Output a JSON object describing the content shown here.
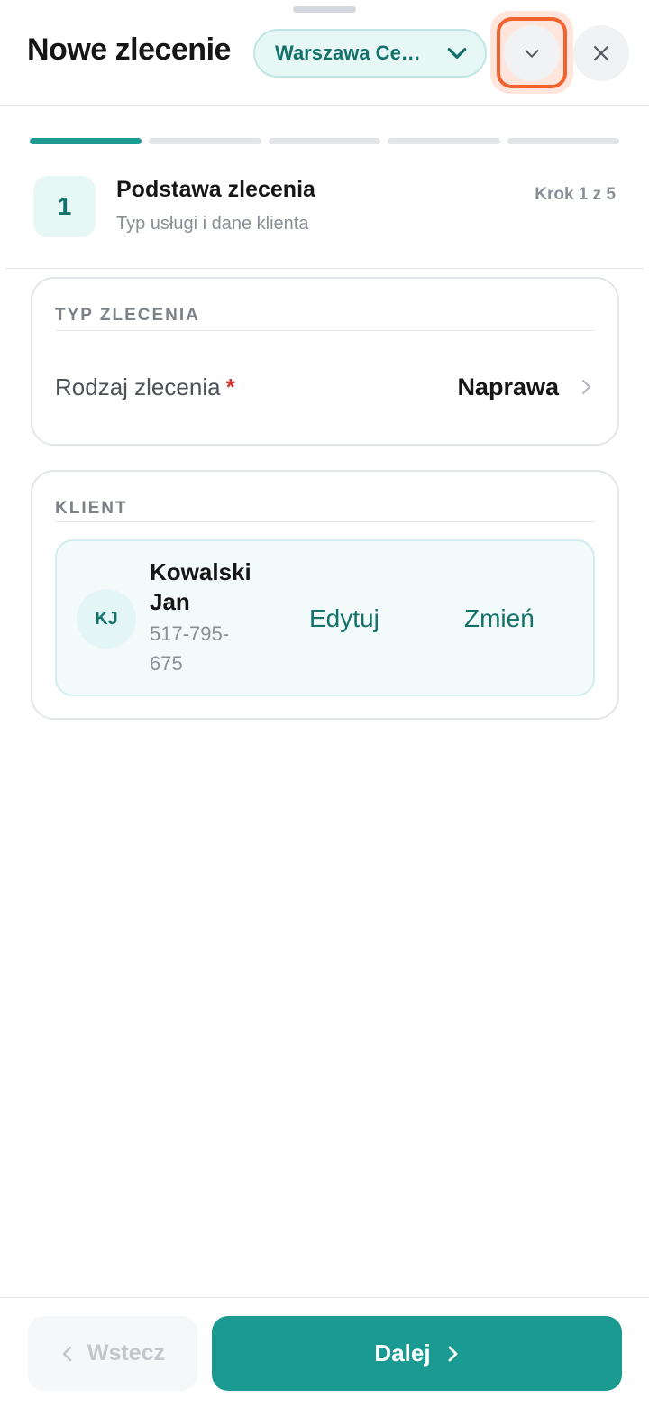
{
  "header": {
    "title": "Nowe zlecenie",
    "branch_selector": "Warszawa Ce…",
    "collapse_icon": "chevron-down-icon",
    "close_icon": "close-icon"
  },
  "progress": {
    "total_steps": 5,
    "current_step": 1
  },
  "step": {
    "number": "1",
    "title": "Podstawa zlecenia",
    "subtitle": "Typ usługi i dane klienta",
    "counter": "Krok 1 z 5"
  },
  "order_type": {
    "heading": "TYP ZLECENIA",
    "field_label": "Rodzaj zlecenia",
    "required_mark": "*",
    "field_value": "Naprawa"
  },
  "client": {
    "heading": "KLIENT",
    "initials": "KJ",
    "name": "Kowalski Jan",
    "phone": "517-795-675",
    "edit_label": "Edytuj",
    "change_label": "Zmień"
  },
  "footer": {
    "back_label": "Wstecz",
    "next_label": "Dalej"
  },
  "colors": {
    "accent": "#1b9a91",
    "accent_dark": "#13716b",
    "focus_ring": "#f2622c",
    "required": "#d0342c"
  }
}
